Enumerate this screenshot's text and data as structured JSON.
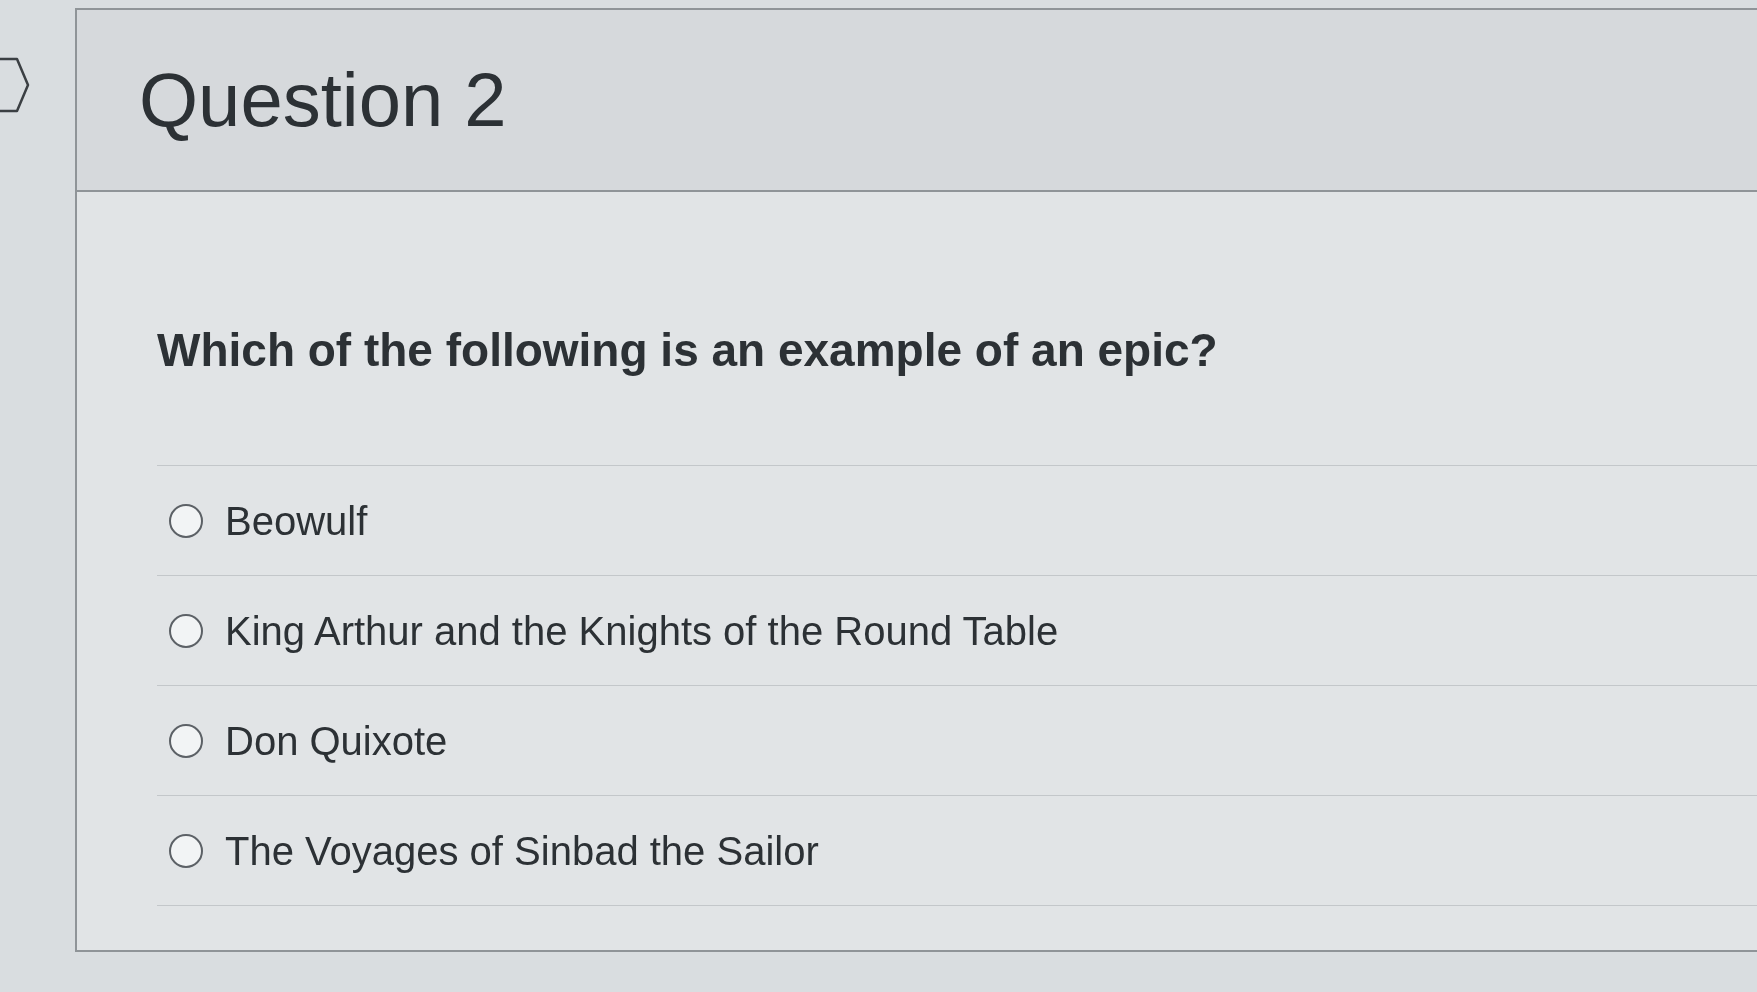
{
  "question": {
    "title": "Question 2",
    "prompt": "Which of the following is an example of an epic?"
  },
  "answers": [
    {
      "label": "Beowulf",
      "selected": false
    },
    {
      "label": "King Arthur and the Knights of the Round Table",
      "selected": false
    },
    {
      "label": "Don Quixote",
      "selected": false
    },
    {
      "label": "The Voyages of Sinbad the Sailor",
      "selected": false
    }
  ]
}
